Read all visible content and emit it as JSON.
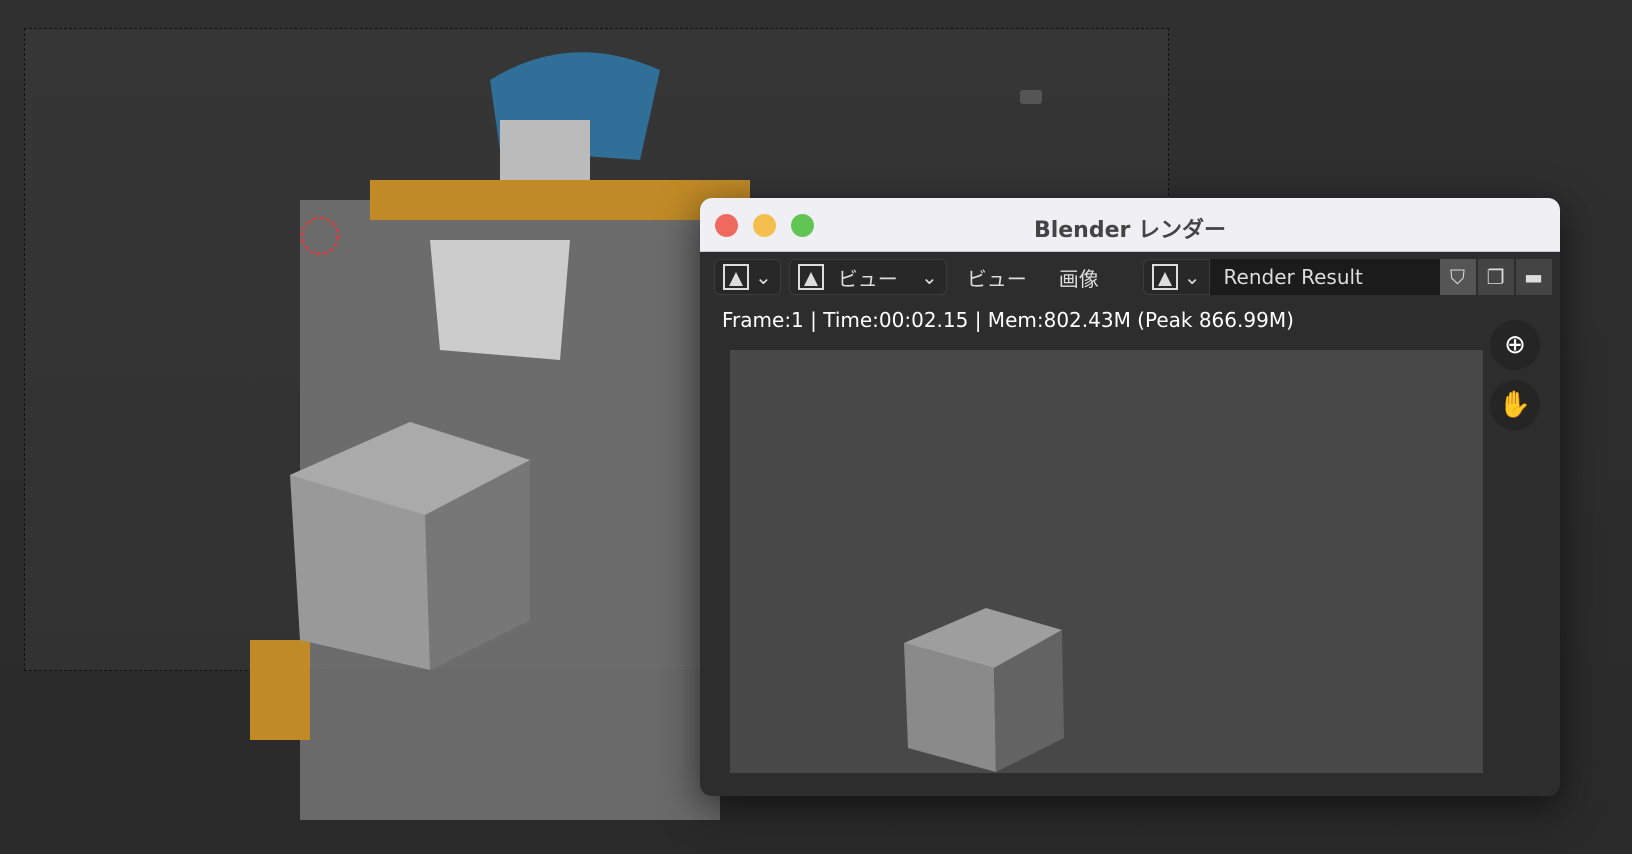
{
  "window": {
    "title": "Blender レンダー",
    "close_color": "#ee6a5e",
    "min_color": "#f5bf4f",
    "max_color": "#61c554"
  },
  "toolbar": {
    "editor_type_icon": "image-editor-icon",
    "view_menu_dropdown": "ビュー",
    "view_menu": "ビュー",
    "image_menu": "画像",
    "image_name": "Render Result"
  },
  "status": "Frame:1 | Time:00:02.15 | Mem:802.43M (Peak 866.99M)",
  "icons": {
    "zoom": "zoom-in-icon",
    "pan": "hand-icon",
    "shield": "fake-user-shield-icon",
    "copy": "duplicate-icon",
    "folder": "open-folder-icon"
  }
}
